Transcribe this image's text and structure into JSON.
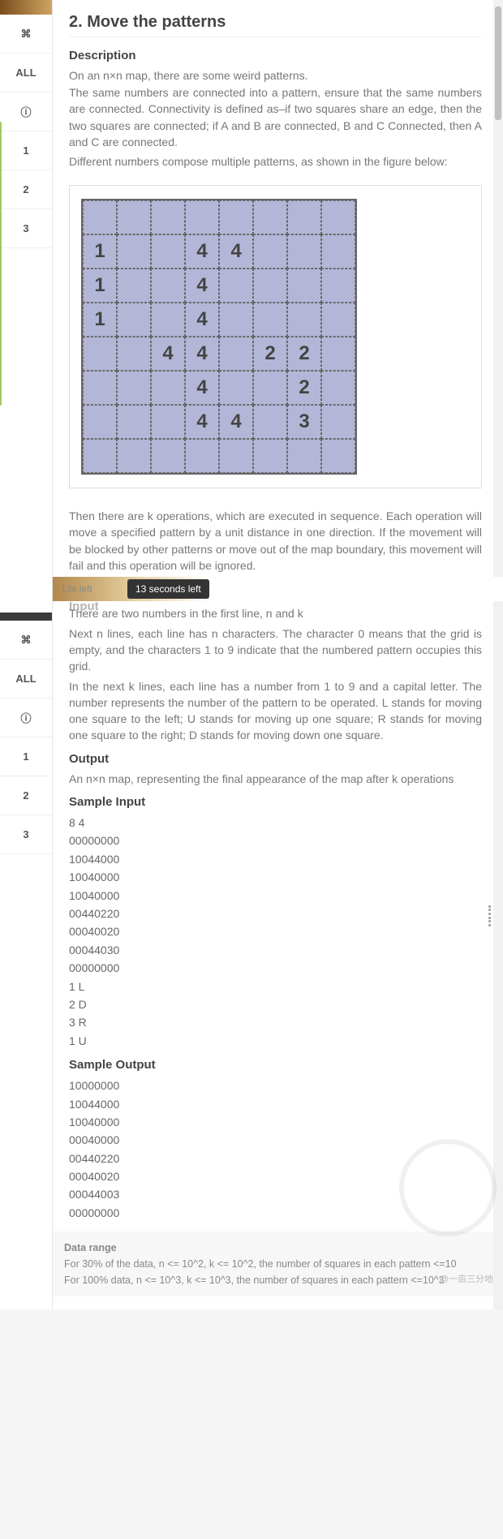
{
  "sidebar": {
    "items": [
      {
        "label": "⌘"
      },
      {
        "label": "ALL"
      },
      {
        "label": "ⓘ"
      },
      {
        "label": "1"
      },
      {
        "label": "2"
      },
      {
        "label": "3"
      }
    ]
  },
  "title": "2. Move the patterns",
  "description_heading": "Description",
  "desc_p1": "On an n×n map, there are some weird patterns.",
  "desc_p2": "The same numbers are connected into a pattern, ensure that the same numbers are connected. Connectivity is defined as–if two squares share an edge, then the two squares are connected; if A and B are connected, B and C Connected, then A and C are connected.",
  "desc_p3": "Different numbers compose multiple patterns, as shown in the figure below:",
  "grid_cells": [
    "",
    "",
    "",
    "",
    "",
    "",
    "",
    "",
    "1",
    "",
    "",
    "4",
    "4",
    "",
    "",
    "",
    "1",
    "",
    "",
    "4",
    "",
    "",
    "",
    "",
    "1",
    "",
    "",
    "4",
    "",
    "",
    "",
    "",
    "",
    "",
    "4",
    "4",
    "",
    "2",
    "2",
    "",
    "",
    "",
    "",
    "4",
    "",
    "",
    "2",
    "",
    "",
    "",
    "",
    "4",
    "4",
    "",
    "3",
    "",
    "",
    "",
    "",
    "",
    "",
    "",
    "",
    ""
  ],
  "desc_p4": "Then there are k operations, which are executed in sequence. Each operation will move a specified pattern by a unit distance in one direction. If the movement will be blocked by other patterns or move out of the map boundary, this movement will fail and this operation will be ignored.",
  "timer_short": "13s left",
  "timer_tooltip": "13 seconds left",
  "input_heading": "Input",
  "input_p1": "There are two numbers in the first line, n and k",
  "input_p2": "Next n lines, each line has n characters. The character 0 means that the grid is empty, and the characters 1 to 9 indicate that the numbered pattern occupies this grid.",
  "input_p3": "In the next k lines, each line has a number from 1 to 9 and a capital letter. The number represents the number of the pattern to be operated. L stands for moving one square to the left; U stands for moving up one square; R stands for moving one square to the right; D stands for moving down one square.",
  "output_heading": "Output",
  "output_p1": "An n×n map, representing the final appearance of the map after k operations",
  "sample_input_heading": "Sample Input",
  "sample_input_lines": [
    "8 4",
    "00000000",
    "10044000",
    "10040000",
    "10040000",
    "00440220",
    "00040020",
    "00044030",
    "00000000",
    "1 L",
    "2 D",
    "3 R",
    "1 U"
  ],
  "sample_output_heading": "Sample Output",
  "sample_output_lines": [
    "10000000",
    "10044000",
    "10040000",
    "00040000",
    "00440220",
    "00040020",
    "00044003",
    "00000000"
  ],
  "datarange_heading": "Data range",
  "datarange_p1": "For 30% of the data, n <= 10^2, k <= 10^2, the number of squares in each pattern <=10",
  "datarange_p2": "For 100% data, n <= 10^3, k <= 10^3, the number of squares in each pattern <=10^3",
  "watermark_text": "@一亩三分地"
}
